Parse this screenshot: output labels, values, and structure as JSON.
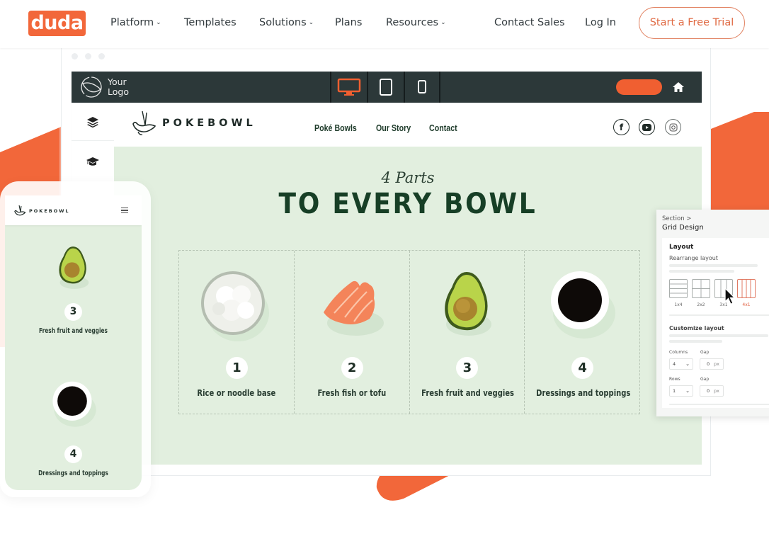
{
  "nav": {
    "brand": "duda",
    "items": [
      {
        "label": "Platform",
        "has_dropdown": true
      },
      {
        "label": "Templates",
        "has_dropdown": false
      },
      {
        "label": "Solutions",
        "has_dropdown": true
      },
      {
        "label": "Plans",
        "has_dropdown": false
      },
      {
        "label": "Resources",
        "has_dropdown": true
      }
    ],
    "contact_sales": "Contact Sales",
    "login": "Log In",
    "cta": "Start a Free Trial",
    "chevron": "⌄"
  },
  "colors": {
    "brand_orange": "#f2673a",
    "editor_dark": "#2c3839",
    "canvas_green": "#e2efdf",
    "heading_green": "#173f26"
  },
  "editor": {
    "logo_placeholder": [
      "Your",
      "Logo"
    ],
    "devices": [
      {
        "name": "desktop",
        "active": true
      },
      {
        "name": "tablet",
        "active": false
      },
      {
        "name": "mobile",
        "active": false
      }
    ],
    "rail_icons": [
      "layers-icon",
      "graduation-cap-icon"
    ]
  },
  "site": {
    "brand": "POKEBOWL",
    "nav": [
      "Poké Bowls",
      "Our Story",
      "Contact"
    ],
    "social": [
      "facebook-icon",
      "youtube-icon",
      "instagram-icon"
    ],
    "script_title": "4 Parts",
    "title": "TO EVERY BOWL",
    "parts": [
      {
        "number": "1",
        "label": "Rice or noodle base",
        "image": "rice-bowl"
      },
      {
        "number": "2",
        "label": "Fresh fish or tofu",
        "image": "salmon"
      },
      {
        "number": "3",
        "label": "Fresh fruit and veggies",
        "image": "avocado"
      },
      {
        "number": "4",
        "label": "Dressings and toppings",
        "image": "soy-sauce"
      }
    ]
  },
  "panel": {
    "breadcrumb": "Section >",
    "title": "Grid Design",
    "layout_heading": "Layout",
    "rearrange_label": "Rearrange layout",
    "layout_options": [
      {
        "label": "1x4",
        "active": false
      },
      {
        "label": "2x2",
        "active": false
      },
      {
        "label": "3x1",
        "active": false
      },
      {
        "label": "4x1",
        "active": true
      }
    ],
    "customize_heading": "Customize layout",
    "columns_label": "Columns",
    "columns_value": "4",
    "col_gap_label": "Gap",
    "col_gap_value": "0",
    "rows_label": "Rows",
    "rows_value": "1",
    "row_gap_label": "Gap",
    "row_gap_value": "0",
    "unit": "px"
  },
  "mobile": {
    "brand": "POKEBOWL",
    "items": [
      {
        "number": "3",
        "label": "Fresh fruit and veggies"
      },
      {
        "number": "4",
        "label": "Dressings and toppings"
      }
    ]
  }
}
